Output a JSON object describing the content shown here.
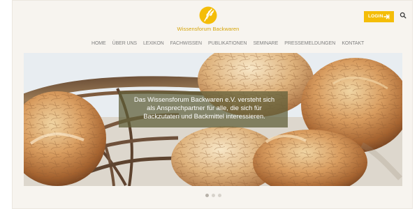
{
  "site": {
    "logo_text": "Wissensforum Backwaren",
    "accent_color": "#f4bd08",
    "logo_color": "#d6a407"
  },
  "header": {
    "login_label": "LOGIN",
    "login_icon": "arrow-right-icon",
    "search_icon": "search-icon"
  },
  "navigation": {
    "items": [
      {
        "label": "HOME"
      },
      {
        "label": "ÜBER UNS"
      },
      {
        "label": "LEXIKON"
      },
      {
        "label": "FACHWISSEN"
      },
      {
        "label": "PUBLIKATIONEN"
      },
      {
        "label": "SEMINARE"
      },
      {
        "label": "PRESSEMELDUNGEN"
      },
      {
        "label": "KONTAKT"
      }
    ]
  },
  "hero": {
    "caption": "Das Wissensforum Backwaren e.V. versteht sich als Ansprechpartner für alle, die sich für Backzutaten und Backmittel interessieren.",
    "dots_count": 3,
    "active_dot_index": 0
  }
}
